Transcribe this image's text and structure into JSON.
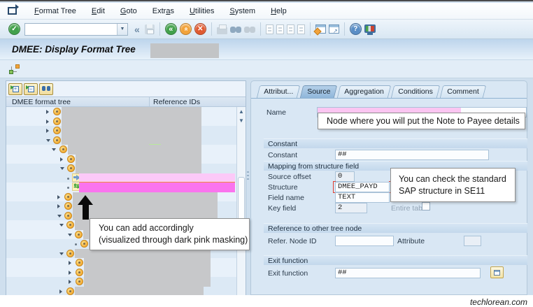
{
  "menu": {
    "items": [
      {
        "label": "Format Tree",
        "accel": 0
      },
      {
        "label": "Edit",
        "accel": 0
      },
      {
        "label": "Goto",
        "accel": 0
      },
      {
        "label": "Extras",
        "accel": 4
      },
      {
        "label": "Utilities",
        "accel": 0
      },
      {
        "label": "System",
        "accel": 0
      },
      {
        "label": "Help",
        "accel": 0
      }
    ]
  },
  "toolbar": {
    "command_value": "",
    "icons": [
      "enter-check-icon",
      "command-field",
      "collapse-chevrons-icon",
      "save-icon",
      "back-icon",
      "exit-icon",
      "cancel-icon",
      "print-icon",
      "find-icon",
      "find-next-icon",
      "first-page-icon",
      "page-up-icon",
      "page-down-icon",
      "last-page-icon",
      "new-session-icon",
      "create-shortcut-icon",
      "help-icon",
      "gui-settings-icon"
    ]
  },
  "header": {
    "title": "DMEE: Display Format Tree"
  },
  "left_panel": {
    "toolbar_icons": [
      "expand-subtree-icon",
      "collapse-subtree-icon",
      "find-icon"
    ],
    "columns": {
      "col1": "DMEE format tree",
      "col2": "Reference IDs"
    },
    "tree": {
      "row_height": 13.5,
      "rows": [
        {
          "e": "r",
          "ex": 57,
          "icon": "node",
          "ix": 67,
          "mask": [
            79,
            279
          ]
        },
        {
          "e": "r",
          "ex": 57,
          "icon": "node",
          "ix": 67,
          "mask": [
            79,
            279
          ]
        },
        {
          "e": "r",
          "ex": 57,
          "icon": "node",
          "ix": 67,
          "mask": [
            79,
            279
          ]
        },
        {
          "e": "d",
          "ex": 57,
          "icon": "node",
          "ix": 67,
          "mask": [
            79,
            279
          ],
          "green_mark": 204
        },
        {
          "e": "d",
          "ex": 65,
          "icon": "node",
          "ix": 76,
          "mask": [
            88,
            279
          ]
        },
        {
          "e": "r",
          "ex": 77,
          "icon": "node",
          "ix": 87,
          "mask": [
            99,
            279
          ]
        },
        {
          "e": "d",
          "ex": 77,
          "icon": "node",
          "ix": 87,
          "mask": [
            99,
            279
          ]
        },
        {
          "e": "dot",
          "ex": 87,
          "icon": "arrow",
          "ix": 94,
          "highlight": "light",
          "hl": [
            104,
            327
          ]
        },
        {
          "e": "dot",
          "ex": 87,
          "icon": "segment",
          "ix": 94,
          "highlight": "bright",
          "hl": [
            104,
            327
          ]
        },
        {
          "e": "r",
          "ex": 73,
          "icon": "node",
          "ix": 83,
          "mask": [
            95,
            302
          ]
        },
        {
          "e": "r",
          "ex": 73,
          "icon": "node",
          "ix": 83,
          "mask": [
            95,
            302
          ]
        },
        {
          "e": "d",
          "ex": 73,
          "icon": "node",
          "ix": 83,
          "mask": [
            95,
            302
          ]
        },
        {
          "e": "d",
          "ex": 76,
          "icon": "node",
          "ix": 86,
          "mask": [
            98,
            272
          ]
        },
        {
          "e": "d",
          "ex": 88,
          "icon": "node",
          "ix": 98,
          "mask": [
            110,
            272
          ]
        },
        {
          "e": "dot",
          "ex": 98,
          "icon": "node",
          "ix": 106,
          "mask": [
            118,
            272
          ]
        },
        {
          "e": "d",
          "ex": 76,
          "icon": "node",
          "ix": 86,
          "mask": [
            98,
            292
          ]
        },
        {
          "e": "r",
          "ex": 89,
          "icon": "node",
          "ix": 99,
          "mask": [
            111,
            292
          ]
        },
        {
          "e": "r",
          "ex": 89,
          "icon": "node",
          "ix": 99,
          "mask": [
            111,
            292
          ]
        },
        {
          "e": "r",
          "ex": 89,
          "icon": "node",
          "ix": 99,
          "mask": [
            111,
            292
          ]
        },
        {
          "e": "r",
          "ex": 76,
          "icon": "node",
          "ix": 86,
          "mask": [
            98,
            282
          ]
        }
      ]
    }
  },
  "right_panel": {
    "tabs": [
      {
        "label": "Attribut...",
        "active": false
      },
      {
        "label": "Source",
        "active": true
      },
      {
        "label": "Aggregation",
        "active": false
      },
      {
        "label": "Conditions",
        "active": false
      },
      {
        "label": "Comment",
        "active": false
      }
    ],
    "name_label": "Name",
    "sections": {
      "constant": {
        "title": "Constant",
        "label": "Constant",
        "value": "##"
      },
      "mapping": {
        "title": "Mapping from structure field",
        "rows": [
          {
            "label": "Source offset",
            "value": "0"
          },
          {
            "label": "Structure",
            "value": "DMEE_PAYD"
          },
          {
            "label": "Field name",
            "value": "TEXT"
          },
          {
            "label": "Key field",
            "value": "2"
          }
        ],
        "entire_table_label": "Entire table"
      },
      "reference": {
        "title": "Reference to other tree node",
        "label": "Refer. Node ID",
        "value": "",
        "attribute_label": "Attribute",
        "attribute_value": ""
      },
      "exit": {
        "title": "Exit function",
        "label": "Exit function",
        "value": "##"
      }
    }
  },
  "callouts": {
    "name_note": "Node where you will put the Note to Payee details",
    "se11_line1": "You can check the standard",
    "se11_line2": "SAP structure in SE11",
    "add_line1": "You can add accordingly",
    "add_line2": "(visualized through dark pink masking)"
  },
  "colors": {
    "highlight_light_pink": "#fcc9f8",
    "highlight_bright_pink": "#fa74ee",
    "name_mask_pink": "#fbc6f2",
    "redaction_gray": "#c7c8ca",
    "node_icon_orange": "#f3ae37",
    "panel_blue": "#d9e7f4"
  },
  "watermark": "techlorean.com"
}
